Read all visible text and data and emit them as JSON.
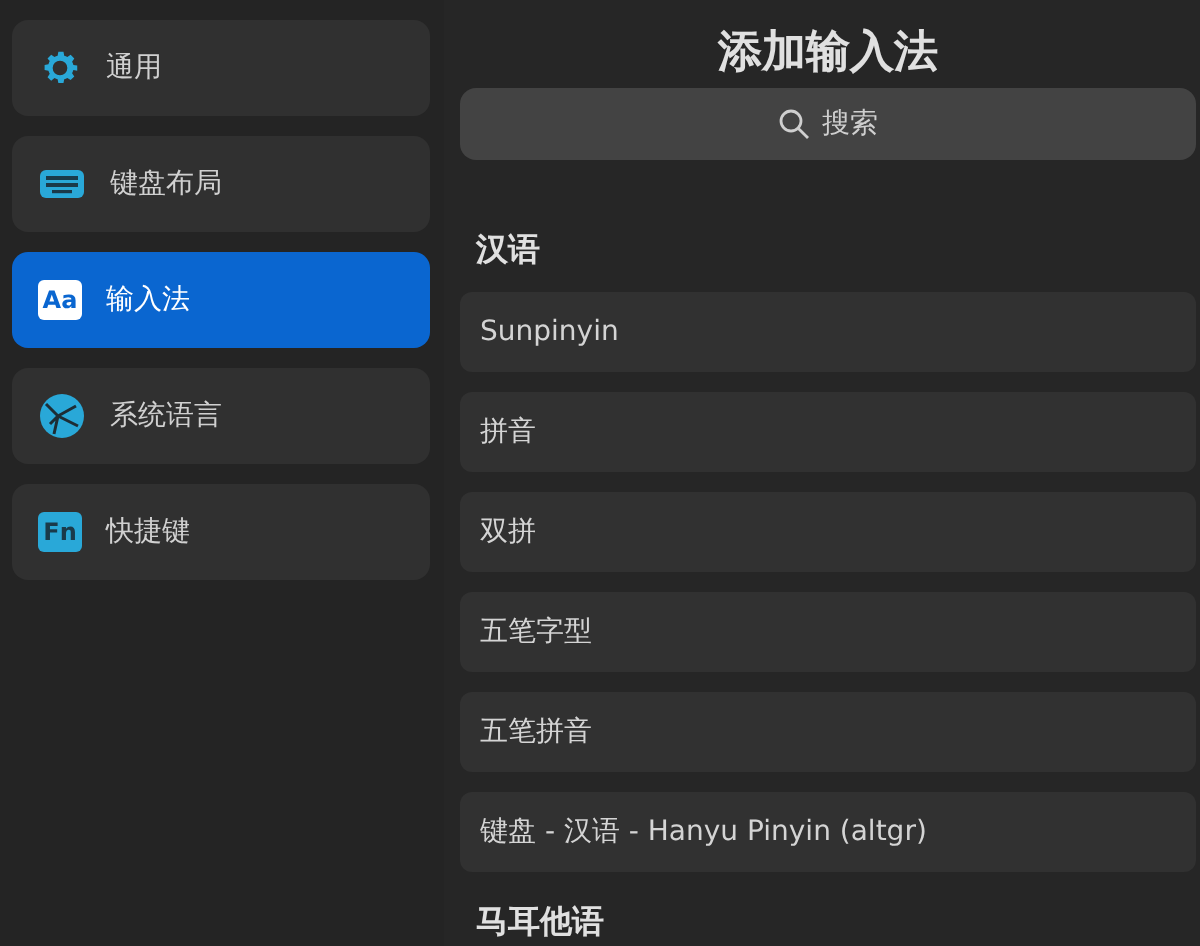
{
  "sidebar": {
    "items": [
      {
        "label": "通用",
        "selected": false
      },
      {
        "label": "键盘布局",
        "selected": false
      },
      {
        "label": "输入法",
        "icon_text": "Aa",
        "selected": true
      },
      {
        "label": "系统语言",
        "selected": false
      },
      {
        "label": "快捷键",
        "icon_text": "Fn",
        "selected": false
      }
    ]
  },
  "main": {
    "title": "添加输入法",
    "search": {
      "placeholder": "搜索"
    },
    "groups": [
      {
        "heading": "汉语",
        "items": [
          "Sunpinyin",
          "拼音",
          "双拼",
          "五笔字型",
          "五笔拼音",
          "键盘 - 汉语 - Hanyu Pinyin (altgr)"
        ]
      },
      {
        "heading": "马耳他语"
      }
    ]
  }
}
